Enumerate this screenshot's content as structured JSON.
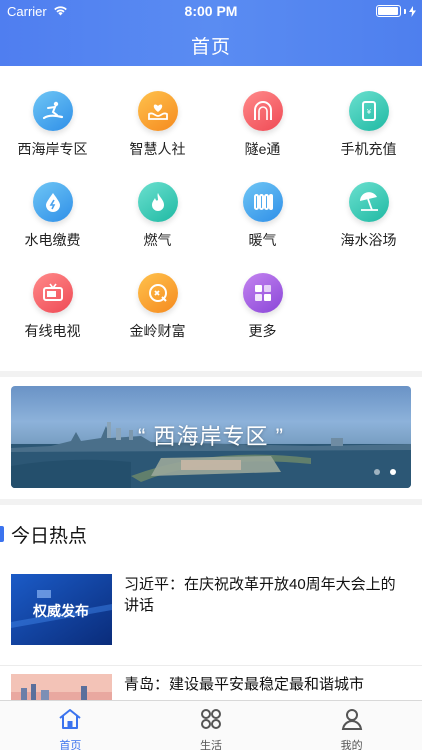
{
  "status_bar": {
    "carrier": "Carrier",
    "time": "8:00 PM",
    "battery_level": 0.95
  },
  "nav": {
    "title": "首页"
  },
  "services": [
    {
      "label": "西海岸专区",
      "icon": "surfing-icon",
      "color_from": "#6fc6f5",
      "color_to": "#2f8fe8"
    },
    {
      "label": "智慧人社",
      "icon": "heart-hand-icon",
      "color_from": "#ffc24d",
      "color_to": "#f58a1f"
    },
    {
      "label": "隧e通",
      "icon": "tunnel-icon",
      "color_from": "#ff8a8a",
      "color_to": "#ef4a55"
    },
    {
      "label": "手机充值",
      "icon": "phone-topup-icon",
      "color_from": "#6be0cf",
      "color_to": "#1fb9a3"
    },
    {
      "label": "水电缴费",
      "icon": "water-drop-icon",
      "color_from": "#6fc6f5",
      "color_to": "#2f8fe8"
    },
    {
      "label": "燃气",
      "icon": "flame-icon",
      "color_from": "#6be0cf",
      "color_to": "#1fb9a3"
    },
    {
      "label": "暖气",
      "icon": "radiator-icon",
      "color_from": "#6fc6f5",
      "color_to": "#2f8fe8"
    },
    {
      "label": "海水浴场",
      "icon": "beach-umbrella-icon",
      "color_from": "#6be0cf",
      "color_to": "#1fb9a3"
    },
    {
      "label": "有线电视",
      "icon": "tv-icon",
      "color_from": "#ff8a8a",
      "color_to": "#ef4a55"
    },
    {
      "label": "金岭财富",
      "icon": "wallet-icon",
      "color_from": "#ffc24d",
      "color_to": "#f58a1f"
    },
    {
      "label": "更多",
      "icon": "more-grid-icon",
      "color_from": "#c484f0",
      "color_to": "#8a46d8"
    }
  ],
  "banner": {
    "text": "“ 西海岸专区 ”",
    "active_dot": 1
  },
  "news": {
    "section_title": "今日热点",
    "items": [
      {
        "title": "习近平：在庆祝改革开放40周年大会上的讲话",
        "thumb_text": "权威发布"
      },
      {
        "title": "青岛：建设最平安最稳定最和谐城市",
        "thumb_text": ""
      }
    ]
  },
  "tabs": [
    {
      "label": "首页",
      "icon": "home-icon",
      "active": true
    },
    {
      "label": "生活",
      "icon": "clover-icon",
      "active": false
    },
    {
      "label": "我的",
      "icon": "person-icon",
      "active": false
    }
  ],
  "colors": {
    "accent": "#3b73ee",
    "tab_inactive": "#555555"
  }
}
